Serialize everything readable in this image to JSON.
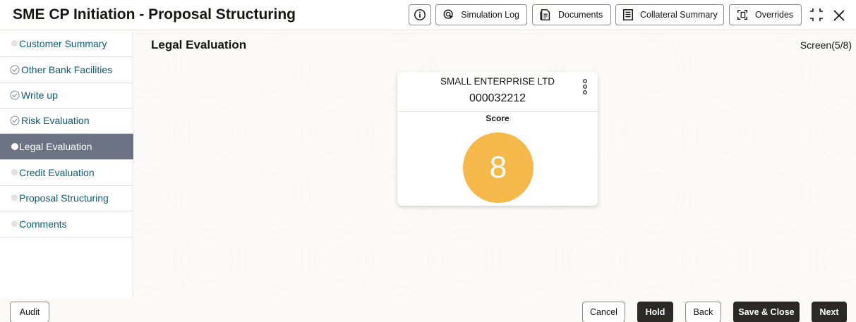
{
  "header": {
    "title": "SME CP Initiation - Proposal Structuring",
    "buttons": {
      "simulation_log": "Simulation Log",
      "documents": "Documents",
      "collateral_summary": "Collateral Summary",
      "overrides": "Overrides"
    }
  },
  "sidebar": {
    "items": [
      {
        "label": "Customer Summary",
        "state": "pending"
      },
      {
        "label": "Other Bank Facilities",
        "state": "done"
      },
      {
        "label": "Write up",
        "state": "done"
      },
      {
        "label": "Risk Evaluation",
        "state": "done"
      },
      {
        "label": "Legal Evaluation",
        "state": "active"
      },
      {
        "label": "Credit Evaluation",
        "state": "pending"
      },
      {
        "label": "Proposal Structuring",
        "state": "pending"
      },
      {
        "label": "Comments",
        "state": "pending"
      }
    ]
  },
  "main": {
    "section_title": "Legal Evaluation",
    "screen_indicator": "Screen(5/8)",
    "card": {
      "customer_name": "SMALL ENTERPRISE LTD",
      "customer_id": "000032212",
      "score_label": "Score",
      "score_value": "8",
      "score_color": "#f5b84a"
    }
  },
  "footer": {
    "audit": "Audit",
    "cancel": "Cancel",
    "hold": "Hold",
    "back": "Back",
    "save_close": "Save & Close",
    "next": "Next"
  },
  "colors": {
    "active_nav_bg": "#6b7385",
    "nav_text": "#0c5a73",
    "primary_button": "#2a2926"
  }
}
